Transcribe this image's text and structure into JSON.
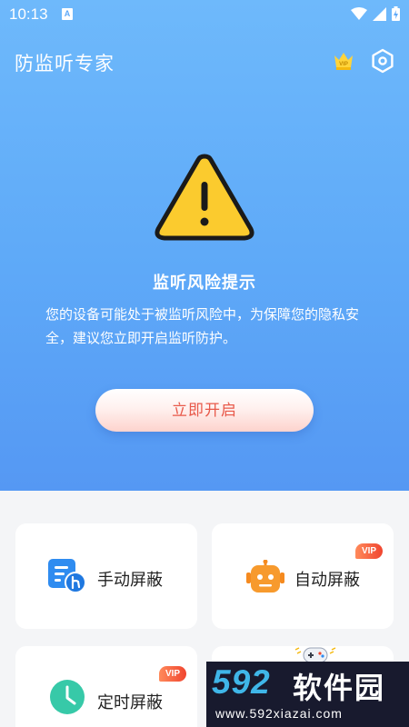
{
  "status": {
    "time": "10:13",
    "notification_glyph": "A"
  },
  "header": {
    "title": "防监听专家",
    "vip_icon_text": "VIP"
  },
  "alert": {
    "title": "监听风险提示",
    "description": "您的设备可能处于被监听风险中，为保障您的隐私安全，建议您立即开启监听防护。",
    "button_label": "立即开启"
  },
  "features": [
    {
      "label": "手动屏蔽",
      "icon": "manual-block-icon",
      "vip": false
    },
    {
      "label": "自动屏蔽",
      "icon": "robot-icon",
      "vip": true,
      "vip_text": "VIP"
    },
    {
      "label": "定时屏蔽",
      "icon": "clock-icon",
      "vip": true,
      "vip_text": "VIP"
    },
    {
      "label": "",
      "icon": "gamepad-icon",
      "vip": false
    }
  ],
  "watermark": {
    "brand_number": "592",
    "brand_text": "软件园",
    "url": "www.592xiazai.com"
  },
  "colors": {
    "accent": "#5ea9f8",
    "button_text": "#e8594a",
    "warning": "#fbcb2e",
    "vip_badge": "#f0452f"
  }
}
